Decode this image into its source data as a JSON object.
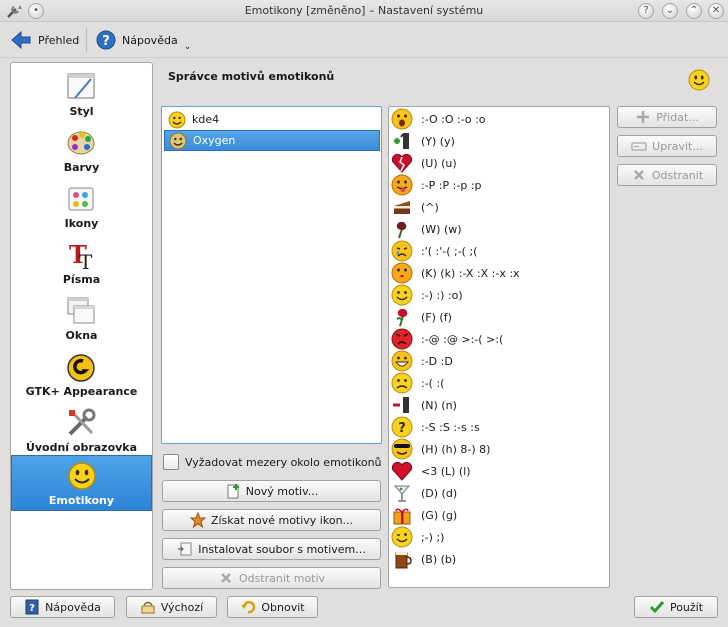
{
  "window": {
    "title": "Emotikony [změněno] – Nastavení systému"
  },
  "toolbar": {
    "overview_label": "Přehled",
    "help_label": "Nápověda"
  },
  "sidebar": {
    "items": [
      {
        "label": "Styl"
      },
      {
        "label": "Barvy"
      },
      {
        "label": "Ikony"
      },
      {
        "label": "Písma"
      },
      {
        "label": "Okna"
      },
      {
        "label": "GTK+ Appearance"
      },
      {
        "label": "Úvodní obrazovka"
      },
      {
        "label": "Emotikony"
      }
    ]
  },
  "main": {
    "title": "Správce motivů emotikonů",
    "themes": [
      "kde4",
      "Oxygen"
    ],
    "require_spaces_label": "Vyžadovat mezery okolo emotikonů",
    "new_theme_label": "Nový motiv...",
    "get_new_label": "Získat nové motivy ikon...",
    "install_label": "Instalovat soubor s motivem...",
    "remove_theme_label": "Odstranit motiv",
    "add_label": "Přidat...",
    "edit_label": "Upravit...",
    "remove_label": "Odstranit",
    "emoticons": [
      ":-O :O :-o :o",
      "(Y) (y)",
      "(U) (u)",
      ":-P :P :-p :p",
      "(^)",
      "(W) (w)",
      ":'( :'-( ;-( ;(",
      "(K) (k) :-X :X :-x :x",
      ":-) :) :o)",
      "(F) (f)",
      ":-@ :@ >:-( >:(",
      ":-D :D",
      ":-( :(",
      "(N) (n)",
      ":-S :S :-s :s",
      "(H) (h) 8-) 8)",
      "<3 (L) (l)",
      "(D) (d)",
      "(G) (g)",
      ";-) ;)",
      "(B) (b)"
    ]
  },
  "footer": {
    "help_label": "Nápověda",
    "defaults_label": "Výchozí",
    "reset_label": "Obnovit",
    "apply_label": "Použít"
  }
}
